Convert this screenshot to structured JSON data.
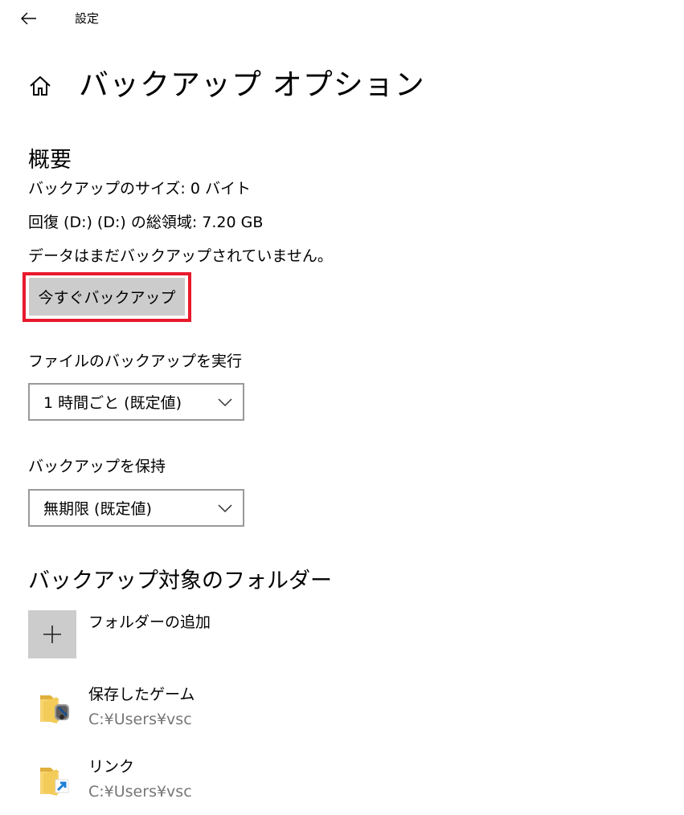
{
  "window": {
    "title": "設定"
  },
  "page": {
    "title": "バックアップ オプション"
  },
  "overview": {
    "heading": "概要",
    "backup_size": "バックアップのサイズ: 0 バイト",
    "total_space": "回復 (D:) (D:) の総領域: 7.20 GB",
    "status": "データはまだバックアップされていません。",
    "backup_now_label": "今すぐバックアップ"
  },
  "frequency": {
    "label": "ファイルのバックアップを実行",
    "selected": "1 時間ごと (既定値)"
  },
  "retention": {
    "label": "バックアップを保持",
    "selected": "無期限 (既定値)"
  },
  "folders": {
    "heading": "バックアップ対象のフォルダー",
    "add_label": "フォルダーの追加",
    "items": [
      {
        "name": "保存したゲーム",
        "path": "C:¥Users¥vsc",
        "icon": "saved-games-folder-icon"
      },
      {
        "name": "リンク",
        "path": "C:¥Users¥vsc",
        "icon": "links-folder-icon"
      }
    ]
  },
  "colors": {
    "highlight": "#e8192c",
    "button_bg": "#cccccc",
    "dropdown_border": "#999999",
    "secondary_text": "#767676"
  }
}
